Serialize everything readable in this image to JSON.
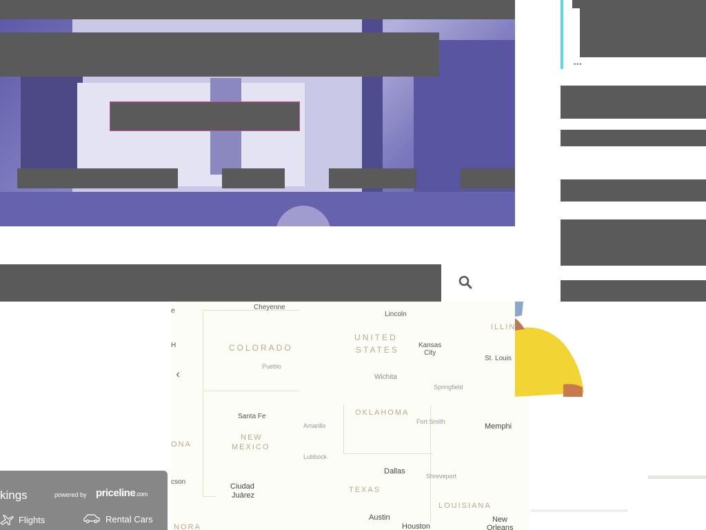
{
  "map": {
    "prev_label": "‹",
    "regions": {
      "colorado": "COLORADO",
      "united_states_1": "UNITED",
      "united_states_2": "STATES",
      "oklahoma": "OKLAHOMA",
      "new_mexico_1": "NEW",
      "new_mexico_2": "MEXICO",
      "texas": "TEXAS",
      "louisiana": "LOUISIANA",
      "illinois": "ILLIN",
      "arizona": "ONA",
      "sonora": "NORA"
    },
    "cities": {
      "cheyenne": "Cheyenne",
      "lincoln": "Lincoln",
      "kansas_city_1": "Kansas",
      "kansas_city_2": "City",
      "st_louis": "St. Louis",
      "pueblo": "Pueblo",
      "wichita": "Wichita",
      "springfield": "Springfield",
      "santa_fe": "Santa Fe",
      "amarillo": "Amarillo",
      "fort_smith": "Fort Smith",
      "memphis": "Memphi",
      "lubbock": "Lubbock",
      "dallas": "Dallas",
      "shreveport": "Shreveport",
      "tucson": "cson",
      "ciudad_juarez_1": "Ciudad",
      "ciudad_juarez_2": "Juárez",
      "austin": "Austin",
      "houston": "Houston",
      "new_orleans_1": "New",
      "new_orleans_2": "Orleans",
      "edge_h": "H",
      "edge_e": "e"
    }
  },
  "sidebar": {
    "more_label": "•••"
  },
  "booking": {
    "title": "kings",
    "powered_by": "powered by",
    "brand": "priceline",
    "brand_suffix": ".com",
    "tabs": [
      {
        "label": "Flights",
        "icon": "plane-icon"
      },
      {
        "label": "Rental Cars",
        "icon": "car-icon"
      }
    ]
  },
  "colors": {
    "redaction": "#5a5a5a",
    "hero_tint": "#7d7ac0",
    "accent_cyan": "#5ad6f0",
    "cta_border": "#c94a9a",
    "widget_bg": "#878787",
    "shirt_yellow": "#f2d434"
  }
}
